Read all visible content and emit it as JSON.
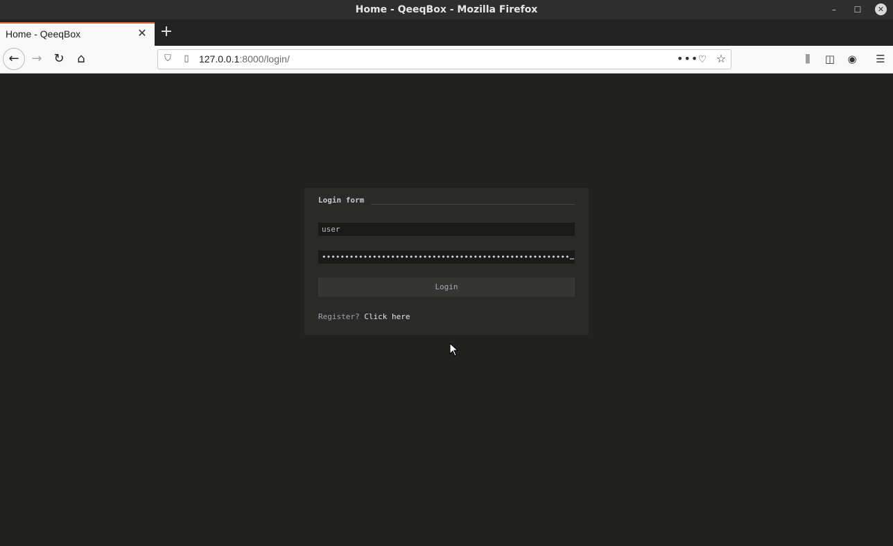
{
  "window": {
    "title": "Home - QeeqBox - Mozilla Firefox",
    "minimize_icon": "minimize-icon",
    "maximize_icon": "maximize-icon",
    "close_icon": "close-icon"
  },
  "tab": {
    "title": "Home - QeeqBox",
    "accent_color": "#e86a3a"
  },
  "nav": {
    "url_host": "127.0.0.1",
    "url_rest": ":8000/login/",
    "more_label": "•••"
  },
  "login": {
    "legend": "Login form",
    "username_value": "user",
    "password_value": "••••••••••••••••••••••••••••••••••••••••••••••••••••••…",
    "submit_label": "Login",
    "register_prompt": "Register?",
    "register_link": "Click here"
  },
  "colors": {
    "page_bg": "#212220",
    "card_bg": "#2a2b29",
    "input_bg": "#1a1a18",
    "button_bg": "#353634"
  }
}
